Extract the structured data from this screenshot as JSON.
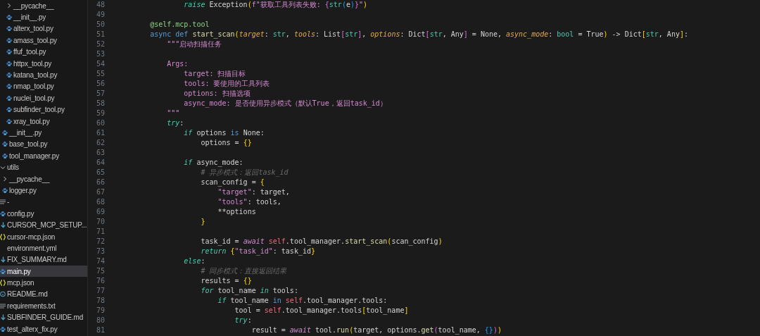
{
  "sidebar": {
    "items": [
      {
        "kind": "group",
        "children": [
          {
            "kind": "group",
            "children": [
              {
                "label": "__pycache__",
                "kind": "folder",
                "expanded": false
              },
              {
                "label": "__init__.py",
                "kind": "python",
                "selected": false
              },
              {
                "label": "alterx_tool.py",
                "kind": "python",
                "selected": false
              },
              {
                "label": "amass_tool.py",
                "kind": "python",
                "selected": false
              },
              {
                "label": "ffuf_tool.py",
                "kind": "python",
                "selected": false
              },
              {
                "label": "httpx_tool.py",
                "kind": "python",
                "selected": false
              },
              {
                "label": "katana_tool.py",
                "kind": "python",
                "selected": false
              },
              {
                "label": "nmap_tool.py",
                "kind": "python",
                "selected": false
              },
              {
                "label": "nuclei_tool.py",
                "kind": "python",
                "selected": false
              },
              {
                "label": "subfinder_tool.py",
                "kind": "python",
                "selected": false
              },
              {
                "label": "xray_tool.py",
                "kind": "python",
                "selected": false
              }
            ]
          },
          {
            "label": "__init__.py",
            "kind": "python",
            "selected": false
          },
          {
            "label": "base_tool.py",
            "kind": "python",
            "selected": false
          },
          {
            "label": "tool_manager.py",
            "kind": "python",
            "selected": false
          }
        ]
      },
      {
        "label": "utils",
        "kind": "folder",
        "expanded": true,
        "children": [
          {
            "label": "__pycache__",
            "kind": "folder",
            "expanded": false
          },
          {
            "label": "logger.py",
            "kind": "python",
            "selected": false
          }
        ]
      },
      {
        "label": "-",
        "kind": "text",
        "selected": false
      },
      {
        "label": "config.py",
        "kind": "python",
        "selected": false
      },
      {
        "label": "CURSOR_MCP_SETUP...",
        "kind": "markdown",
        "selected": false
      },
      {
        "label": "cursor-mcp.json",
        "kind": "json",
        "selected": false
      },
      {
        "label": "environment.yml",
        "kind": "yaml",
        "selected": false
      },
      {
        "label": "FIX_SUMMARY.md",
        "kind": "markdown",
        "selected": false
      },
      {
        "label": "main.py",
        "kind": "python",
        "selected": true
      },
      {
        "label": "mcp.json",
        "kind": "json",
        "selected": false
      },
      {
        "label": "README.md",
        "kind": "info",
        "selected": false
      },
      {
        "label": "requirements.txt",
        "kind": "text",
        "selected": false
      },
      {
        "label": "SUBFINDER_GUIDE.md",
        "kind": "markdown",
        "selected": false
      },
      {
        "label": "test_alterx_fix.py",
        "kind": "python",
        "selected": false
      }
    ]
  },
  "editor": {
    "lines": [
      {
        "number": "48",
        "tokens": [
          {
            "kind": "ctl",
            "text": "                raise"
          },
          {
            "kind": "plain",
            "text": " Exception"
          },
          {
            "kind": "br1",
            "text": "("
          },
          {
            "kind": "str",
            "text": "f\"获取工具列表失败: "
          },
          {
            "kind": "br2",
            "text": "{"
          },
          {
            "kind": "type",
            "text": "str"
          },
          {
            "kind": "br3",
            "text": "("
          },
          {
            "kind": "plain",
            "text": "e"
          },
          {
            "kind": "br3",
            "text": ")"
          },
          {
            "kind": "br2",
            "text": "}"
          },
          {
            "kind": "str",
            "text": "\""
          },
          {
            "kind": "br1",
            "text": ")"
          }
        ]
      },
      {
        "number": "49"
      },
      {
        "number": "50",
        "tokens": [
          {
            "kind": "deco",
            "text": "        @self.mcp.tool"
          }
        ]
      },
      {
        "number": "51",
        "tokens": [
          {
            "kind": "kw",
            "text": "        async def"
          },
          {
            "kind": "fn",
            "text": " start_scan"
          },
          {
            "kind": "br1",
            "text": "("
          },
          {
            "kind": "param",
            "text": "target"
          },
          {
            "kind": "plain",
            "text": ": "
          },
          {
            "kind": "type",
            "text": "str"
          },
          {
            "kind": "plain",
            "text": ", "
          },
          {
            "kind": "param",
            "text": "tools"
          },
          {
            "kind": "plain",
            "text": ": List"
          },
          {
            "kind": "br2",
            "text": "["
          },
          {
            "kind": "type",
            "text": "str"
          },
          {
            "kind": "br2",
            "text": "]"
          },
          {
            "kind": "plain",
            "text": ", "
          },
          {
            "kind": "param",
            "text": "options"
          },
          {
            "kind": "plain",
            "text": ": Dict"
          },
          {
            "kind": "br2",
            "text": "["
          },
          {
            "kind": "type",
            "text": "str"
          },
          {
            "kind": "plain",
            "text": ", Any"
          },
          {
            "kind": "br2",
            "text": "]"
          },
          {
            "kind": "plain",
            "text": " = None, "
          },
          {
            "kind": "param",
            "text": "async_mode"
          },
          {
            "kind": "plain",
            "text": ": "
          },
          {
            "kind": "type",
            "text": "bool"
          },
          {
            "kind": "plain",
            "text": " = True"
          },
          {
            "kind": "br1",
            "text": ")"
          },
          {
            "kind": "plain",
            "text": " -> Dict"
          },
          {
            "kind": "br1",
            "text": "["
          },
          {
            "kind": "type",
            "text": "str"
          },
          {
            "kind": "plain",
            "text": ", Any"
          },
          {
            "kind": "br1",
            "text": "]"
          },
          {
            "kind": "plain",
            "text": ":"
          }
        ]
      },
      {
        "number": "52",
        "tokens": [
          {
            "kind": "str",
            "text": "            \"\"\"启动扫描任务"
          }
        ]
      },
      {
        "number": "53"
      },
      {
        "number": "54",
        "tokens": [
          {
            "kind": "str",
            "text": "            Args:"
          }
        ]
      },
      {
        "number": "55",
        "tokens": [
          {
            "kind": "str",
            "text": "                target: 扫描目标"
          }
        ]
      },
      {
        "number": "56",
        "tokens": [
          {
            "kind": "str",
            "text": "                tools: 要使用的工具列表"
          }
        ]
      },
      {
        "number": "57",
        "tokens": [
          {
            "kind": "str",
            "text": "                options: 扫描选项"
          }
        ]
      },
      {
        "number": "58",
        "tokens": [
          {
            "kind": "str",
            "text": "                async_mode: 是否使用异步模式（默认True，返回task_id）"
          }
        ]
      },
      {
        "number": "59",
        "tokens": [
          {
            "kind": "str",
            "text": "            \"\"\""
          }
        ]
      },
      {
        "number": "60",
        "tokens": [
          {
            "kind": "ctl",
            "text": "            try"
          },
          {
            "kind": "plain",
            "text": ":"
          }
        ]
      },
      {
        "number": "61",
        "tokens": [
          {
            "kind": "ctl",
            "text": "                if"
          },
          {
            "kind": "plain",
            "text": " options "
          },
          {
            "kind": "kw",
            "text": "is"
          },
          {
            "kind": "plain",
            "text": " None:"
          }
        ]
      },
      {
        "number": "62",
        "tokens": [
          {
            "kind": "plain",
            "text": "                    options = "
          },
          {
            "kind": "br1",
            "text": "{}"
          }
        ]
      },
      {
        "number": "63"
      },
      {
        "number": "64",
        "tokens": [
          {
            "kind": "ctl",
            "text": "                if"
          },
          {
            "kind": "plain",
            "text": " async_mode:"
          }
        ]
      },
      {
        "number": "65",
        "tokens": [
          {
            "kind": "cmt",
            "text": "                    # 异步模式：返回task_id"
          }
        ]
      },
      {
        "number": "66",
        "tokens": [
          {
            "kind": "plain",
            "text": "                    scan_config = "
          },
          {
            "kind": "br1",
            "text": "{"
          }
        ]
      },
      {
        "number": "67",
        "tokens": [
          {
            "kind": "str",
            "text": "                        \"target\""
          },
          {
            "kind": "plain",
            "text": ": target,"
          }
        ]
      },
      {
        "number": "68",
        "tokens": [
          {
            "kind": "str",
            "text": "                        \"tools\""
          },
          {
            "kind": "plain",
            "text": ": tools,"
          }
        ]
      },
      {
        "number": "69",
        "tokens": [
          {
            "kind": "plain",
            "text": "                        **options"
          }
        ]
      },
      {
        "number": "70",
        "tokens": [
          {
            "kind": "br1",
            "text": "                    }"
          }
        ]
      },
      {
        "number": "71"
      },
      {
        "number": "72",
        "tokens": [
          {
            "kind": "plain",
            "text": "                    task_id = "
          },
          {
            "kind": "await",
            "text": "await"
          },
          {
            "kind": "self",
            "text": " self"
          },
          {
            "kind": "plain",
            "text": ".tool_manager."
          },
          {
            "kind": "fn",
            "text": "start_scan"
          },
          {
            "kind": "br1",
            "text": "("
          },
          {
            "kind": "plain",
            "text": "scan_config"
          },
          {
            "kind": "br1",
            "text": ")"
          }
        ]
      },
      {
        "number": "73",
        "tokens": [
          {
            "kind": "ctl",
            "text": "                    return"
          },
          {
            "kind": "br1",
            "text": " {"
          },
          {
            "kind": "str",
            "text": "\"task_id\""
          },
          {
            "kind": "plain",
            "text": ": task_id"
          },
          {
            "kind": "br1",
            "text": "}"
          }
        ]
      },
      {
        "number": "74",
        "tokens": [
          {
            "kind": "ctl",
            "text": "                else"
          },
          {
            "kind": "plain",
            "text": ":"
          }
        ]
      },
      {
        "number": "75",
        "tokens": [
          {
            "kind": "cmt",
            "text": "                    # 同步模式：直接返回结果"
          }
        ]
      },
      {
        "number": "76",
        "tokens": [
          {
            "kind": "plain",
            "text": "                    results = "
          },
          {
            "kind": "br1",
            "text": "{}"
          }
        ]
      },
      {
        "number": "77",
        "tokens": [
          {
            "kind": "ctl",
            "text": "                    for"
          },
          {
            "kind": "plain",
            "text": " tool_name "
          },
          {
            "kind": "ctl",
            "text": "in"
          },
          {
            "kind": "plain",
            "text": " tools:"
          }
        ]
      },
      {
        "number": "78",
        "tokens": [
          {
            "kind": "ctl",
            "text": "                        if"
          },
          {
            "kind": "plain",
            "text": " tool_name "
          },
          {
            "kind": "kw",
            "text": "in"
          },
          {
            "kind": "self",
            "text": " self"
          },
          {
            "kind": "plain",
            "text": ".tool_manager.tools:"
          }
        ]
      },
      {
        "number": "79",
        "tokens": [
          {
            "kind": "plain",
            "text": "                            tool = "
          },
          {
            "kind": "self",
            "text": "self"
          },
          {
            "kind": "plain",
            "text": ".tool_manager.tools"
          },
          {
            "kind": "br1",
            "text": "["
          },
          {
            "kind": "plain",
            "text": "tool_name"
          },
          {
            "kind": "br1",
            "text": "]"
          }
        ]
      },
      {
        "number": "80",
        "tokens": [
          {
            "kind": "ctl",
            "text": "                            try"
          },
          {
            "kind": "plain",
            "text": ":"
          }
        ]
      },
      {
        "number": "81",
        "tokens": [
          {
            "kind": "plain",
            "text": "                                result = "
          },
          {
            "kind": "await",
            "text": "await"
          },
          {
            "kind": "plain",
            "text": " tool."
          },
          {
            "kind": "fn",
            "text": "run"
          },
          {
            "kind": "br1",
            "text": "("
          },
          {
            "kind": "plain",
            "text": "target, options."
          },
          {
            "kind": "fn",
            "text": "get"
          },
          {
            "kind": "br2",
            "text": "("
          },
          {
            "kind": "plain",
            "text": "tool_name, "
          },
          {
            "kind": "br3",
            "text": "{}"
          },
          {
            "kind": "br2",
            "text": ")"
          },
          {
            "kind": "br1",
            "text": ")"
          }
        ]
      }
    ]
  }
}
